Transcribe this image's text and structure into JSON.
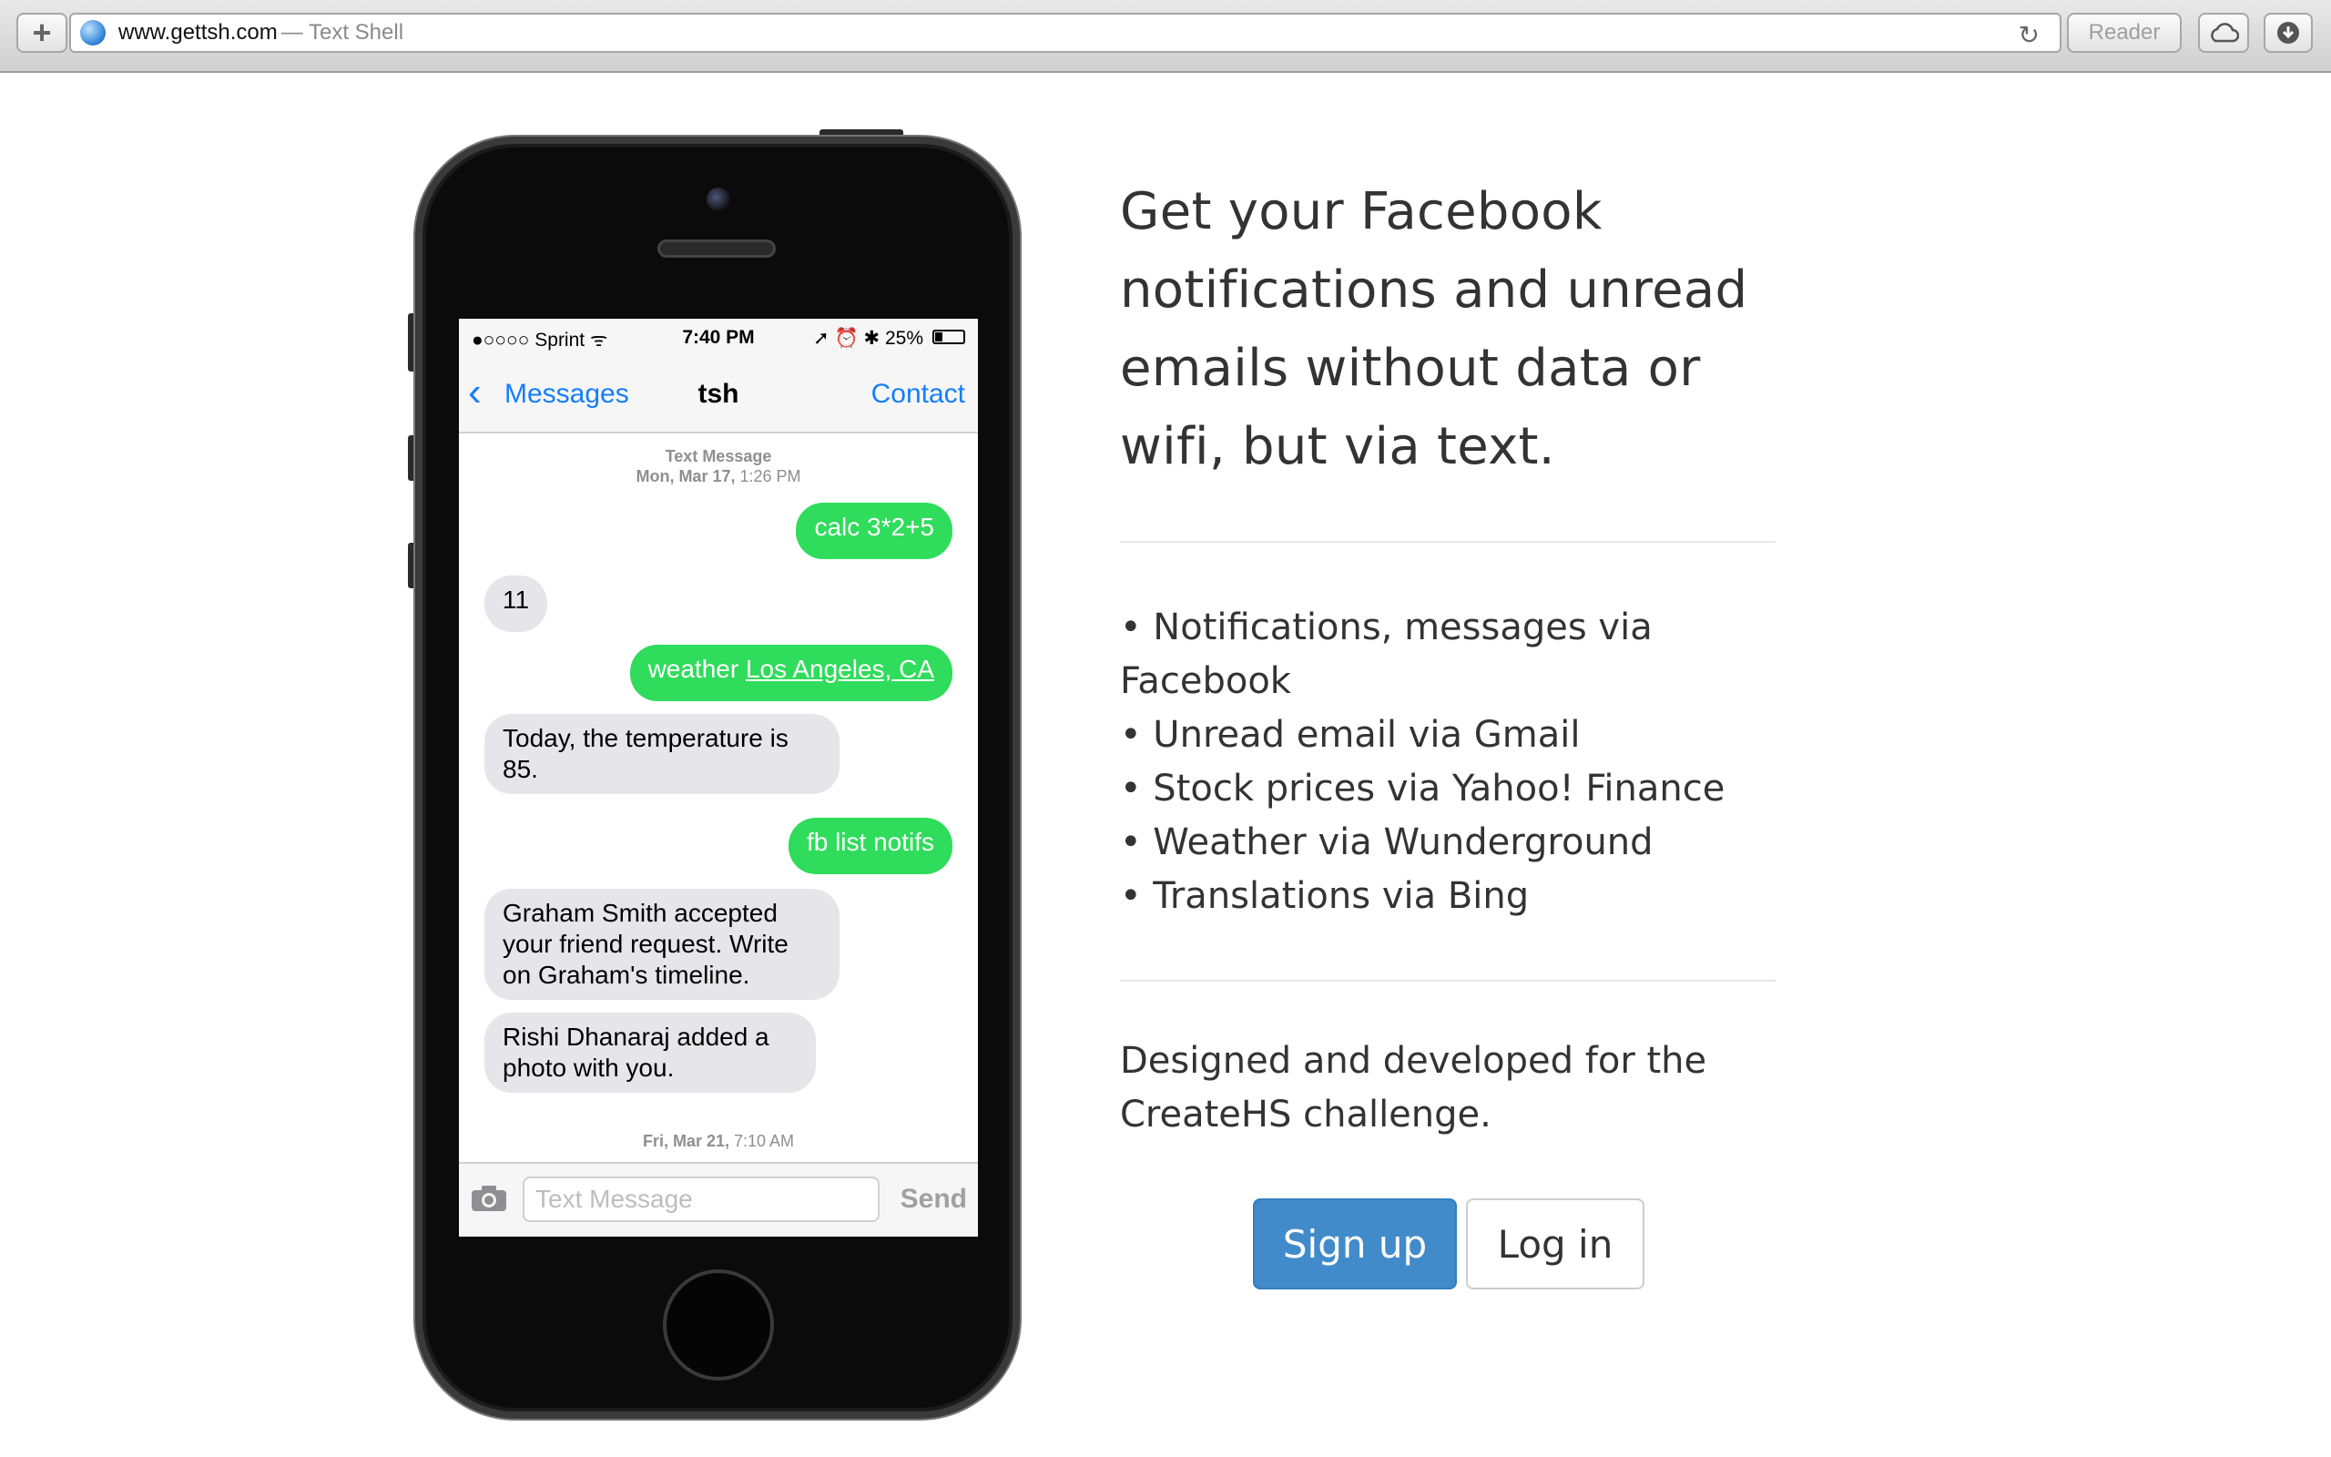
{
  "browser": {
    "url": "www.gettsh.com",
    "page_title": "— Text Shell",
    "reader_label": "Reader",
    "new_tab_label": "+"
  },
  "phone": {
    "status": {
      "carrier": "●○○○○ Sprint ᯤ",
      "time": "7:40 PM",
      "battery": "➚ ⏰ ✱ 25%"
    },
    "nav": {
      "back_label": "Messages",
      "title": "tsh",
      "contact": "Contact"
    },
    "timestamp1": {
      "label": "Text Message",
      "date": "Mon, Mar 17,",
      "time": "1:26 PM"
    },
    "messages": [
      {
        "dir": "out",
        "text": "calc 3*2+5"
      },
      {
        "dir": "in",
        "text": "11"
      },
      {
        "dir": "out",
        "text": "weather ",
        "link": "Los Angeles, CA"
      },
      {
        "dir": "in",
        "text": "Today, the temperature is 85."
      },
      {
        "dir": "out",
        "text": "fb list notifs"
      },
      {
        "dir": "in",
        "text": "Graham Smith accepted your friend request. Write on Graham's timeline."
      },
      {
        "dir": "in",
        "text": "Rishi Dhanaraj added a photo with you."
      }
    ],
    "timestamp2": {
      "date": "Fri, Mar 21,",
      "time": "7:10 AM"
    },
    "composer": {
      "placeholder": "Text Message",
      "send": "Send"
    }
  },
  "content": {
    "headline": "Get your Facebook notifications and unread emails without data or wifi, but via text.",
    "features": [
      "• Notifications, messages via Facebook",
      "• Unread email via Gmail",
      "• Stock prices via Yahoo! Finance",
      "• Weather via Wunderground",
      "• Translations via Bing"
    ],
    "credit": "Designed and developed for the CreateHS challenge.",
    "signup_label": "Sign up",
    "login_label": "Log in"
  },
  "colors": {
    "accent": "#428bca",
    "imessage_green": "#2fdc5b",
    "ios_blue": "#147efb"
  }
}
